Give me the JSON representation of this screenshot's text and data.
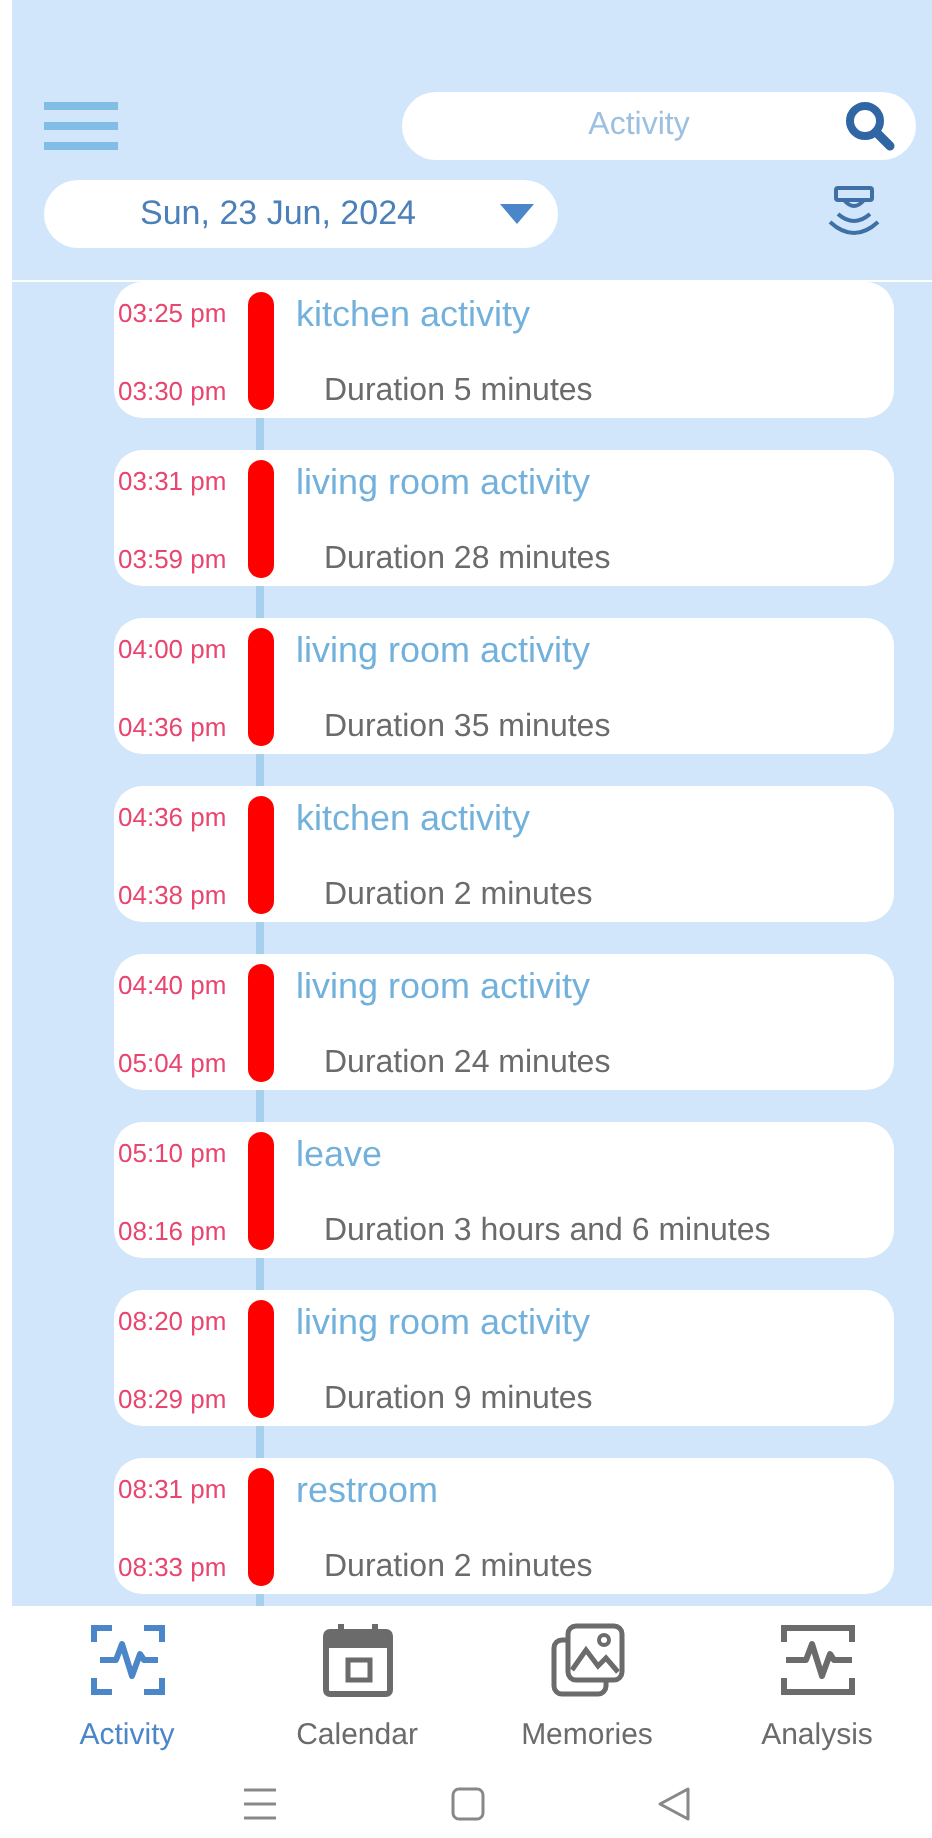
{
  "header": {
    "search": {
      "placeholder": "Activity"
    },
    "date": "Sun, 23 Jun, 2024"
  },
  "events": [
    {
      "start": "03:25 pm",
      "end": "03:30 pm",
      "title": "kitchen activity",
      "duration": "Duration 5 minutes"
    },
    {
      "start": "03:31 pm",
      "end": "03:59 pm",
      "title": "living room activity",
      "duration": "Duration 28 minutes"
    },
    {
      "start": "04:00 pm",
      "end": "04:36 pm",
      "title": "living room activity",
      "duration": "Duration 35 minutes"
    },
    {
      "start": "04:36 pm",
      "end": "04:38 pm",
      "title": "kitchen activity",
      "duration": "Duration 2 minutes"
    },
    {
      "start": "04:40 pm",
      "end": "05:04 pm",
      "title": "living room activity",
      "duration": "Duration 24 minutes"
    },
    {
      "start": "05:10 pm",
      "end": "08:16 pm",
      "title": "leave",
      "duration": "Duration 3 hours and 6 minutes"
    },
    {
      "start": "08:20 pm",
      "end": "08:29 pm",
      "title": "living room activity",
      "duration": "Duration 9 minutes"
    },
    {
      "start": "08:31 pm",
      "end": "08:33 pm",
      "title": "restroom",
      "duration": "Duration 2 minutes"
    }
  ],
  "bottom_nav": [
    {
      "label": "Activity",
      "selected": true
    },
    {
      "label": "Calendar",
      "selected": false
    },
    {
      "label": "Memories",
      "selected": false
    },
    {
      "label": "Analysis",
      "selected": false
    }
  ]
}
